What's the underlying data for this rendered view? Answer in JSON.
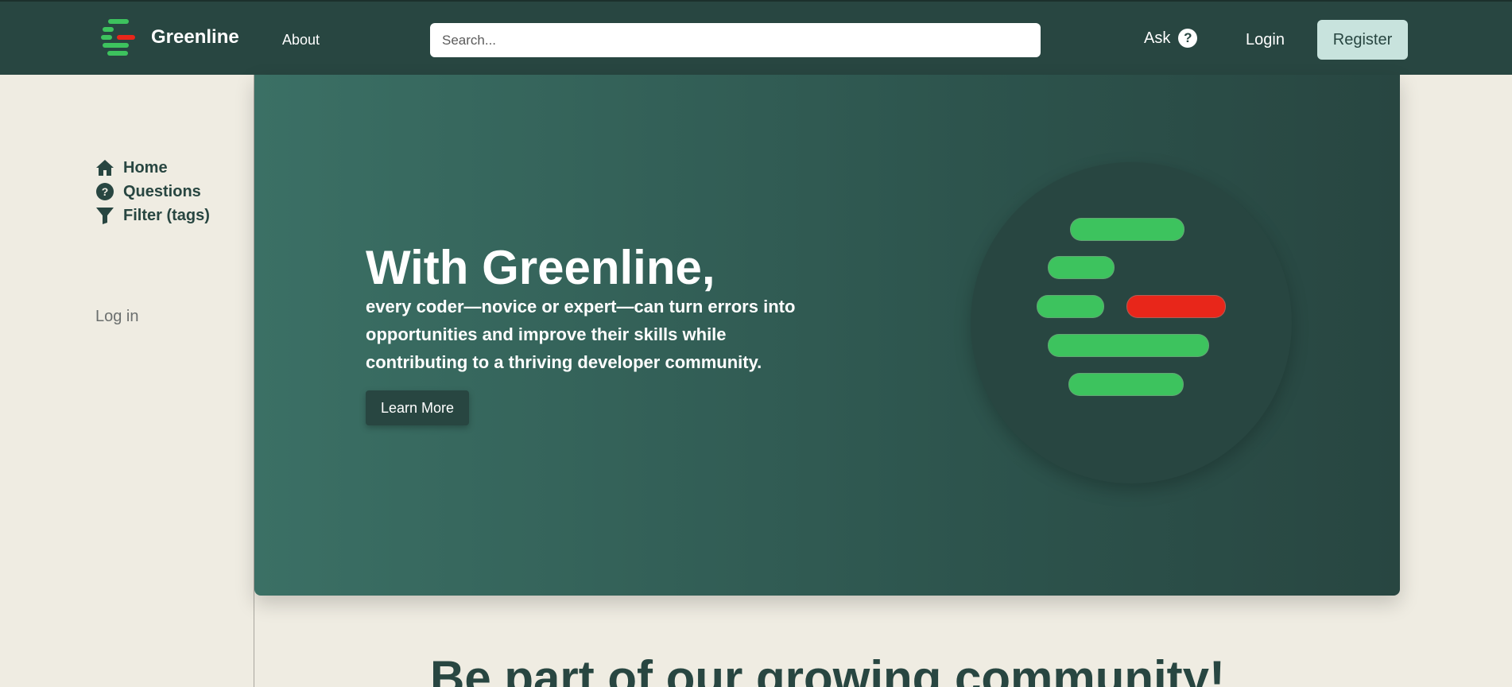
{
  "colors": {
    "navbar": "#284641",
    "page_background": "#efece2",
    "accent_green": "#3dc35e",
    "accent_red": "#e8261a",
    "register_bg": "#c8e3dd"
  },
  "navbar": {
    "brand": "Greenline",
    "about": "About",
    "search_placeholder": "Search...",
    "ask": "Ask",
    "ask_icon": "?",
    "login": "Login",
    "register": "Register"
  },
  "sidebar": {
    "items": [
      {
        "label": "Home",
        "icon": "home-icon"
      },
      {
        "label": "Questions",
        "icon": "question-circle-icon"
      },
      {
        "label": "Filter (tags)",
        "icon": "filter-icon"
      }
    ],
    "login": "Log in"
  },
  "hero": {
    "title": "With Greenline,",
    "text": "every coder—novice or expert—can turn errors into opportunities and improve their skills while contributing to a thriving developer community.",
    "button": "Learn More"
  },
  "community": {
    "heading": "Be part of our growing community!"
  }
}
